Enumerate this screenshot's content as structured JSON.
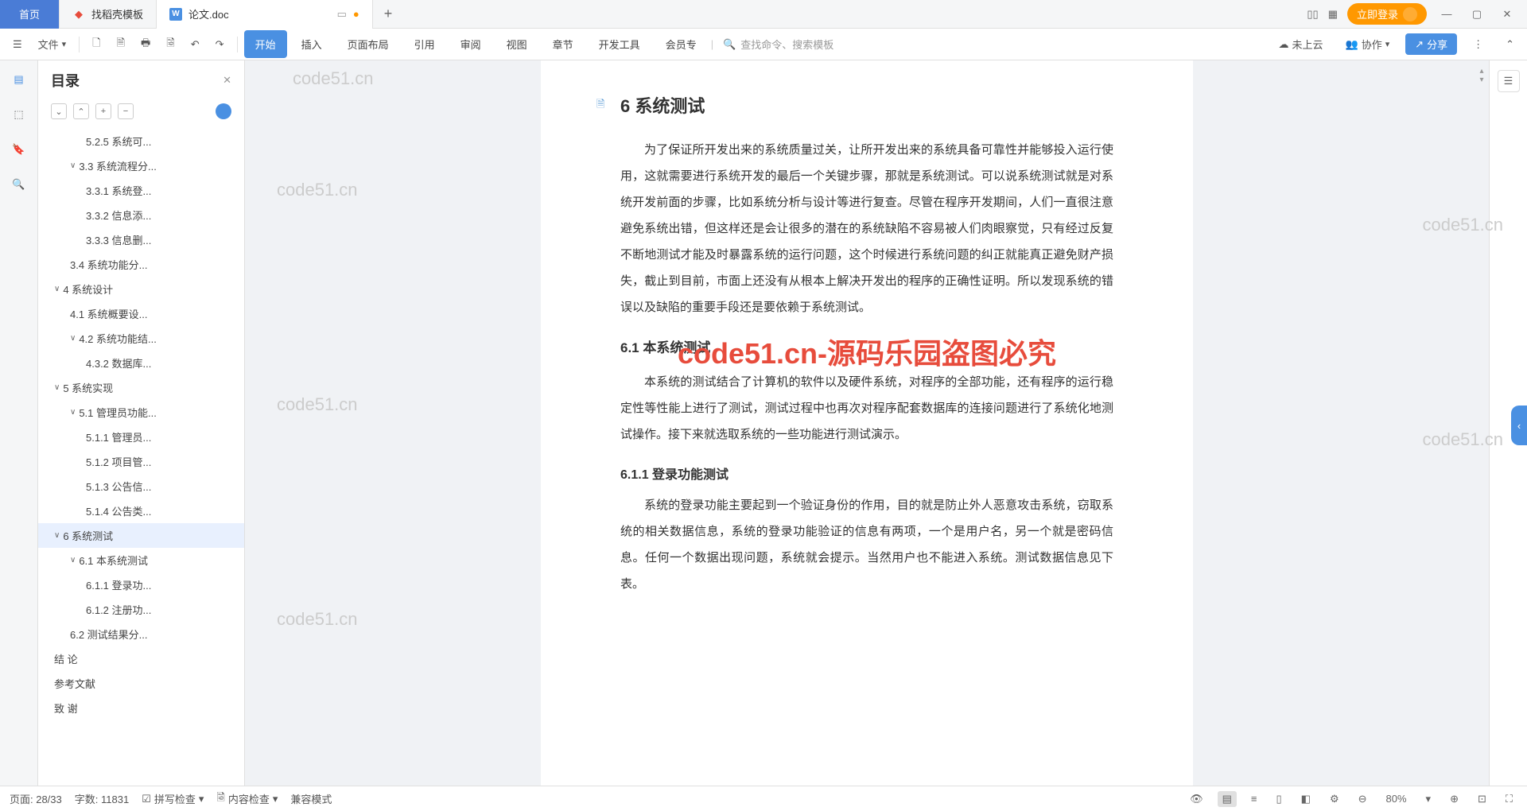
{
  "tabs": {
    "home": "首页",
    "template": "找稻壳模板",
    "doc": "论文.doc"
  },
  "titlebar": {
    "login": "立即登录"
  },
  "toolbar": {
    "file": "文件",
    "menu": {
      "start": "开始",
      "insert": "插入",
      "layout": "页面布局",
      "reference": "引用",
      "review": "审阅",
      "view": "视图",
      "chapter": "章节",
      "devtools": "开发工具",
      "member": "会员专"
    },
    "search_placeholder": "查找命令、搜索模板",
    "cloud": "未上云",
    "collab": "协作",
    "share": "分享"
  },
  "outline": {
    "title": "目录",
    "items": [
      {
        "level": 3,
        "chev": "",
        "text": "5.2.5 系统可..."
      },
      {
        "level": 2,
        "chev": "∨",
        "text": "3.3 系统流程分..."
      },
      {
        "level": 3,
        "chev": "",
        "text": "3.3.1 系统登..."
      },
      {
        "level": 3,
        "chev": "",
        "text": "3.3.2 信息添..."
      },
      {
        "level": 3,
        "chev": "",
        "text": "3.3.3 信息删..."
      },
      {
        "level": 2,
        "chev": "",
        "text": "3.4 系统功能分..."
      },
      {
        "level": 1,
        "chev": "∨",
        "text": "4 系统设计"
      },
      {
        "level": 2,
        "chev": "",
        "text": "4.1 系统概要设..."
      },
      {
        "level": 2,
        "chev": "∨",
        "text": "4.2 系统功能结..."
      },
      {
        "level": 3,
        "chev": "",
        "text": "4.3.2 数据库..."
      },
      {
        "level": 1,
        "chev": "∨",
        "text": "5 系统实现"
      },
      {
        "level": 2,
        "chev": "∨",
        "text": "5.1 管理员功能..."
      },
      {
        "level": 3,
        "chev": "",
        "text": "5.1.1 管理员..."
      },
      {
        "level": 3,
        "chev": "",
        "text": "5.1.2 项目管..."
      },
      {
        "level": 3,
        "chev": "",
        "text": "5.1.3 公告信..."
      },
      {
        "level": 3,
        "chev": "",
        "text": "5.1.4 公告类..."
      },
      {
        "level": 1,
        "chev": "∨",
        "text": "6 系统测试",
        "selected": true
      },
      {
        "level": 2,
        "chev": "∨",
        "text": "6.1 本系统测试"
      },
      {
        "level": 3,
        "chev": "",
        "text": "6.1.1 登录功..."
      },
      {
        "level": 3,
        "chev": "",
        "text": "6.1.2 注册功..."
      },
      {
        "level": 2,
        "chev": "",
        "text": "6.2 测试结果分..."
      },
      {
        "level": 1,
        "chev": "",
        "text": "结  论"
      },
      {
        "level": 1,
        "chev": "",
        "text": "参考文献"
      },
      {
        "level": 1,
        "chev": "",
        "text": "致  谢"
      }
    ]
  },
  "document": {
    "h1": "6 系统测试",
    "p1": "为了保证所开发出来的系统质量过关，让所开发出来的系统具备可靠性并能够投入运行使用，这就需要进行系统开发的最后一个关键步骤，那就是系统测试。可以说系统测试就是对系统开发前面的步骤，比如系统分析与设计等进行复查。尽管在程序开发期间，人们一直很注意避免系统出错，但这样还是会让很多的潜在的系统缺陷不容易被人们肉眼察觉，只有经过反复不断地测试才能及时暴露系统的运行问题，这个时候进行系统问题的纠正就能真正避免财产损失，截止到目前，市面上还没有从根本上解决开发出的程序的正确性证明。所以发现系统的错误以及缺陷的重要手段还是要依赖于系统测试。",
    "h2": "6.1 本系统测试",
    "p2": "本系统的测试结合了计算机的软件以及硬件系统，对程序的全部功能，还有程序的运行稳定性等性能上进行了测试，测试过程中也再次对程序配套数据库的连接问题进行了系统化地测试操作。接下来就选取系统的一些功能进行测试演示。",
    "h3": "6.1.1 登录功能测试",
    "p3": "系统的登录功能主要起到一个验证身份的作用，目的就是防止外人恶意攻击系统，窃取系统的相关数据信息，系统的登录功能验证的信息有两项，一个是用户名，另一个就是密码信息。任何一个数据出现问题，系统就会提示。当然用户也不能进入系统。测试数据信息见下表。"
  },
  "watermarks": {
    "gray": "code51.cn",
    "red": "code51.cn-源码乐园盗图必究"
  },
  "statusbar": {
    "page": "页面: 28/33",
    "words": "字数: 11831",
    "spell": "拼写检查",
    "content": "内容检查",
    "compat": "兼容模式",
    "zoom": "80%"
  }
}
